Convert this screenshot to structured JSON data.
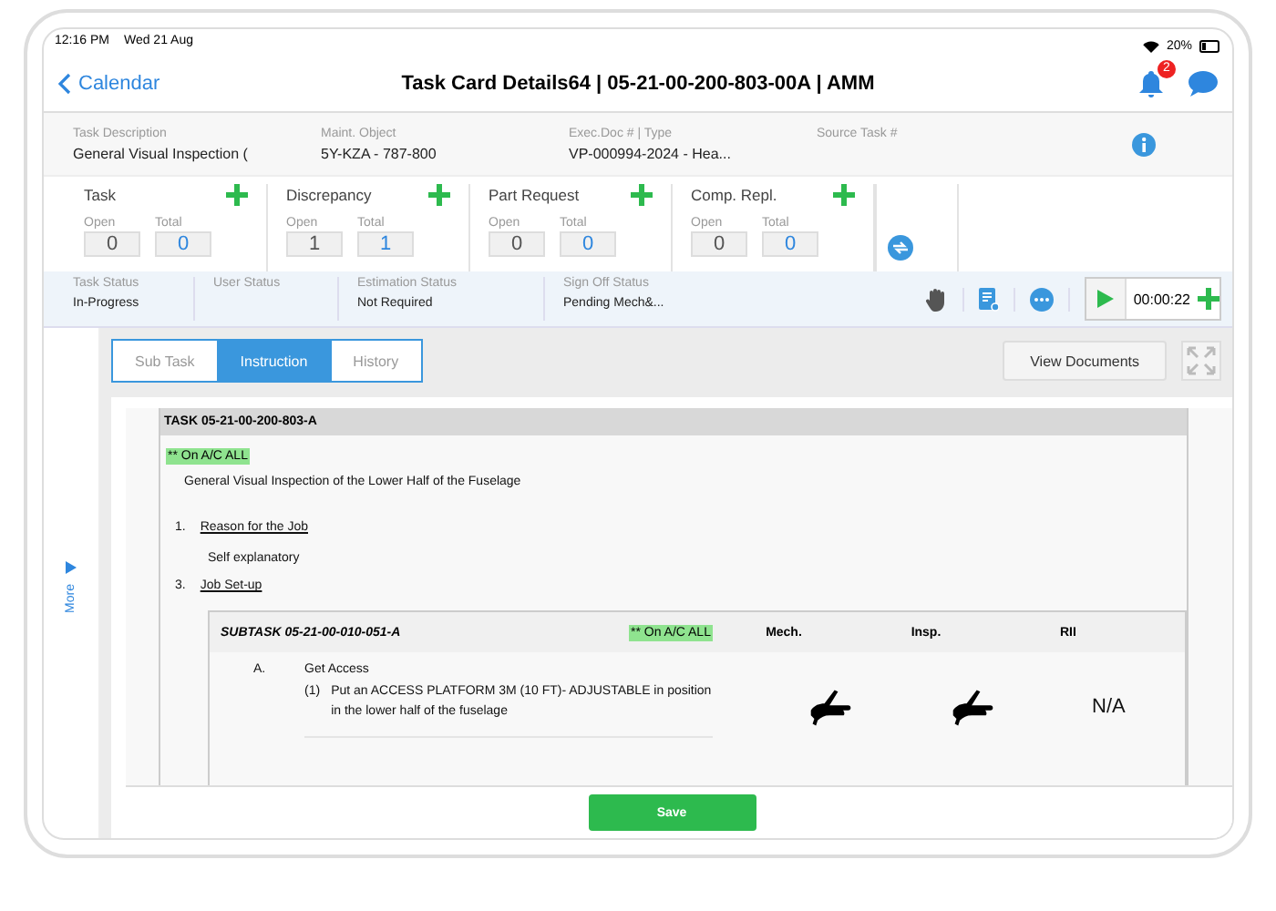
{
  "status_bar": {
    "time": "12:16 PM",
    "date": "Wed 21 Aug",
    "battery": "20%"
  },
  "nav": {
    "back_label": "Calendar",
    "title": "Task Card Details64 | 05-21-00-200-803-00A | AMM",
    "notification_count": "2"
  },
  "info_fields": [
    {
      "label": "Task Description",
      "value": "General Visual Inspection ("
    },
    {
      "label": "Maint. Object",
      "value": "5Y-KZA - 787-800"
    },
    {
      "label": "Exec.Doc # | Type",
      "value": "VP-000994-2024 - Hea..."
    },
    {
      "label": "Source Task #"
    }
  ],
  "counters": [
    {
      "title": "Task",
      "open_label": "Open",
      "total_label": "Total",
      "open": "0",
      "total": "0"
    },
    {
      "title": "Discrepancy",
      "open_label": "Open",
      "total_label": "Total",
      "open": "1",
      "total": "1"
    },
    {
      "title": "Part Request",
      "open_label": "Open",
      "total_label": "Total",
      "open": "0",
      "total": "0"
    },
    {
      "title": "Comp. Repl.",
      "open_label": "Open",
      "total_label": "Total",
      "open": "0",
      "total": "0"
    }
  ],
  "statuses": [
    {
      "label": "Task Status",
      "value": "In-Progress"
    },
    {
      "label": "User Status"
    },
    {
      "label": "Estimation Status",
      "value": "Not Required"
    },
    {
      "label": "Sign Off Status",
      "value": "Pending Mech&..."
    }
  ],
  "timer": "00:00:22",
  "more_label": "More",
  "tabs": [
    {
      "label": "Sub Task",
      "selected": false
    },
    {
      "label": "Instruction",
      "selected": true
    },
    {
      "label": "History",
      "selected": false
    }
  ],
  "view_documents": "View Documents",
  "document": {
    "task_header": "TASK 05-21-00-200-803-A",
    "applicability": "** On A/C ALL",
    "description": "General Visual Inspection of the Lower Half of the Fuselage",
    "steps": [
      {
        "number": "1.",
        "title": "Reason for the Job",
        "body": "Self explanatory"
      },
      {
        "number": "3.",
        "title": "Job Set-up"
      }
    ],
    "subtask": {
      "title": "SUBTASK 05-21-00-010-051-A",
      "applicability": "** On A/C ALL",
      "columns": [
        "Mech.",
        "Insp.",
        "RII"
      ],
      "letter": "A.",
      "heading": "Get Access",
      "item_number": "(1)",
      "item_text": "Put an ACCESS PLATFORM 3M (10 FT)- ADJUSTABLE in position in the lower half of the fuselage",
      "rii_value": "N/A"
    }
  },
  "save_label": "Save"
}
